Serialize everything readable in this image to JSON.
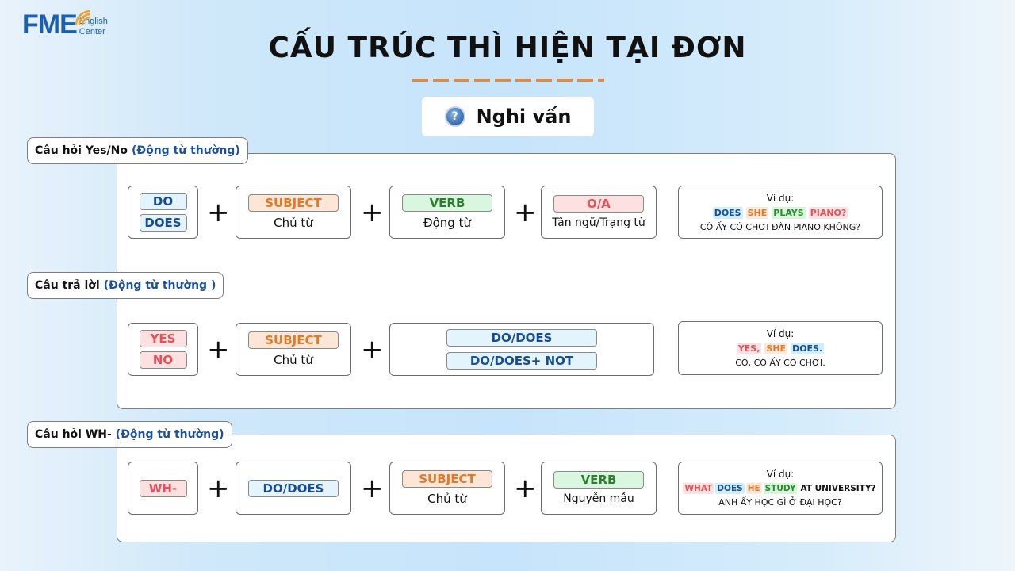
{
  "logo": {
    "mark": "FME",
    "line1": "English",
    "line2": "Center"
  },
  "title": "CẤU TRÚC THÌ HIỆN TẠI ĐƠN",
  "mode": {
    "icon": "question-icon",
    "glyph": "?",
    "label": "Nghi vấn"
  },
  "sections": {
    "yesno": {
      "label": "Câu hỏi Yes/No",
      "hint": "(Động từ thường)",
      "aux": [
        "DO",
        "DOES"
      ],
      "subject": {
        "chip": "SUBJECT",
        "sub": "Chủ từ"
      },
      "verb": {
        "chip": "VERB",
        "sub": "Động từ"
      },
      "object": {
        "chip": "O/A",
        "sub": "Tân ngữ/Trạng từ"
      },
      "plus": "+",
      "example": {
        "title": "Ví dụ:",
        "words": [
          "DOES",
          "SHE",
          "PLAYS",
          "PIANO?"
        ],
        "translation": "CÔ ẤY CÓ CHƠI ĐÀN PIANO KHÔNG?"
      }
    },
    "answer": {
      "label": "Câu trả lời",
      "hint": "(Động từ thường )",
      "yesno": [
        "YES",
        "NO"
      ],
      "subject": {
        "chip": "SUBJECT",
        "sub": "Chủ từ"
      },
      "aux": [
        "DO/DOES",
        "DO/DOES+ NOT"
      ],
      "plus": "+",
      "example": {
        "title": "Ví dụ:",
        "words": [
          "YES,",
          "SHE",
          "DOES."
        ],
        "translation": "CÓ, CÔ ẤY CÓ CHƠI."
      }
    },
    "wh": {
      "label": "Câu hỏi WH-",
      "hint": "(Động từ thường)",
      "wh": "WH-",
      "aux": "DO/DOES",
      "subject": {
        "chip": "SUBJECT",
        "sub": "Chủ từ"
      },
      "verb": {
        "chip": "VERB",
        "sub": "Nguyễn mẫu"
      },
      "plus": "+",
      "example": {
        "title": "Ví dụ:",
        "words": [
          "WHAT",
          "DOES",
          "HE",
          "STUDY",
          "AT UNIVERSITY?"
        ],
        "translation": "ANH ẤY HỌC GÌ Ở ĐẠI HỌC?"
      }
    }
  },
  "colors": {
    "brand": "#1d5fa8",
    "accent_dash": "#e48a3a",
    "blue_text": "#184c94",
    "orange_text": "#e07b2c",
    "green_text": "#2e7d2f",
    "red_text": "#e4505a"
  }
}
